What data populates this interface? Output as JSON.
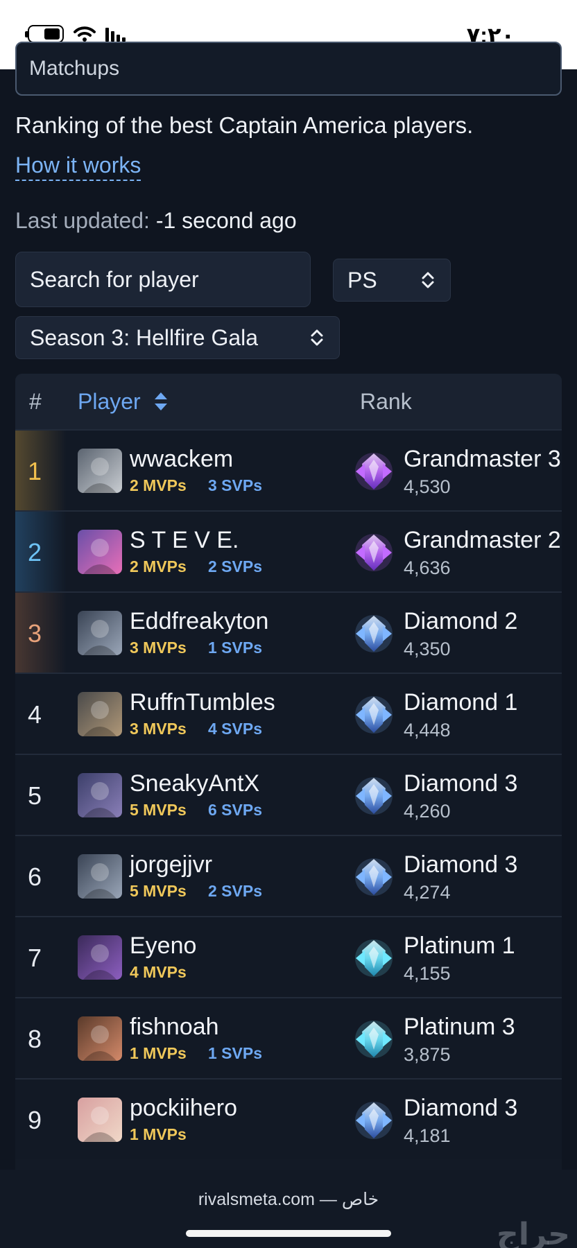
{
  "status_bar": {
    "time": "٧:٢٠"
  },
  "matchups_tab": {
    "label": "Matchups"
  },
  "intro": "Ranking of the best Captain America players.",
  "how_it_works": "How it works",
  "last_updated": {
    "label": "Last updated:",
    "value": "-1 second ago"
  },
  "search": {
    "placeholder": "Search for player"
  },
  "platform_select": {
    "value": "PS"
  },
  "season_select": {
    "value": "Season 3: Hellfire Gala"
  },
  "table": {
    "headers": {
      "num": "#",
      "player": "Player",
      "rank": "Rank"
    },
    "rows": [
      {
        "num": "1",
        "name": "wwackem",
        "mvps": "2 MVPs",
        "svps": "3 SVPs",
        "rank": "Grandmaster 3",
        "score": "4,530",
        "tier": "grandmaster",
        "highlight": "#d9a743",
        "numcolor": "#f2c14e",
        "avatar": [
          "#5b6470",
          "#c9cdd2"
        ]
      },
      {
        "num": "2",
        "name": "S T E V E.",
        "mvps": "2 MVPs",
        "svps": "2 SVPs",
        "rank": "Grandmaster 2",
        "score": "4,636",
        "tier": "grandmaster",
        "highlight": "#3f8fd0",
        "numcolor": "#6ec3f5",
        "avatar": [
          "#6a4fa8",
          "#e86fb8"
        ]
      },
      {
        "num": "3",
        "name": "Eddfreakyton",
        "mvps": "3 MVPs",
        "svps": "1 SVPs",
        "rank": "Diamond 2",
        "score": "4,350",
        "tier": "diamond",
        "highlight": "#b5734a",
        "numcolor": "#e8a27a",
        "avatar": [
          "#3a4455",
          "#9aa6b8"
        ]
      },
      {
        "num": "4",
        "name": "RuffnTumbles",
        "mvps": "3 MVPs",
        "svps": "4 SVPs",
        "rank": "Diamond 1",
        "score": "4,448",
        "tier": "diamond",
        "highlight": "",
        "numcolor": "#e8ecf2",
        "avatar": [
          "#4a4a4a",
          "#b09878"
        ]
      },
      {
        "num": "5",
        "name": "SneakyAntX",
        "mvps": "5 MVPs",
        "svps": "6 SVPs",
        "rank": "Diamond 3",
        "score": "4,260",
        "tier": "diamond",
        "highlight": "",
        "numcolor": "#e8ecf2",
        "avatar": [
          "#3c3f6a",
          "#8a7fb8"
        ]
      },
      {
        "num": "6",
        "name": "jorgejjvr",
        "mvps": "5 MVPs",
        "svps": "2 SVPs",
        "rank": "Diamond 3",
        "score": "4,274",
        "tier": "diamond",
        "highlight": "",
        "numcolor": "#e8ecf2",
        "avatar": [
          "#3a4455",
          "#9aa6b8"
        ]
      },
      {
        "num": "7",
        "name": "Eyeno",
        "mvps": "4 MVPs",
        "svps": "",
        "rank": "Platinum 1",
        "score": "4,155",
        "tier": "platinum",
        "highlight": "",
        "numcolor": "#e8ecf2",
        "avatar": [
          "#3b2a5a",
          "#8d5fc0"
        ]
      },
      {
        "num": "8",
        "name": "fishnoah",
        "mvps": "1 MVPs",
        "svps": "1 SVPs",
        "rank": "Platinum 3",
        "score": "3,875",
        "tier": "platinum",
        "highlight": "",
        "numcolor": "#e8ecf2",
        "avatar": [
          "#5a3a2a",
          "#d48a6a"
        ]
      },
      {
        "num": "9",
        "name": "pockiihero",
        "mvps": "1 MVPs",
        "svps": "",
        "rank": "Diamond 3",
        "score": "4,181",
        "tier": "diamond",
        "highlight": "",
        "numcolor": "#e8ecf2",
        "avatar": [
          "#d8a0a0",
          "#f0d8c8"
        ]
      }
    ]
  },
  "footer": {
    "url": "rivalsmeta.com — خاص",
    "watermark": "حراج"
  },
  "colors": {
    "accent_blue": "#6ea8f2",
    "mvp_gold": "#f0c85a",
    "background": "#0f1520"
  }
}
